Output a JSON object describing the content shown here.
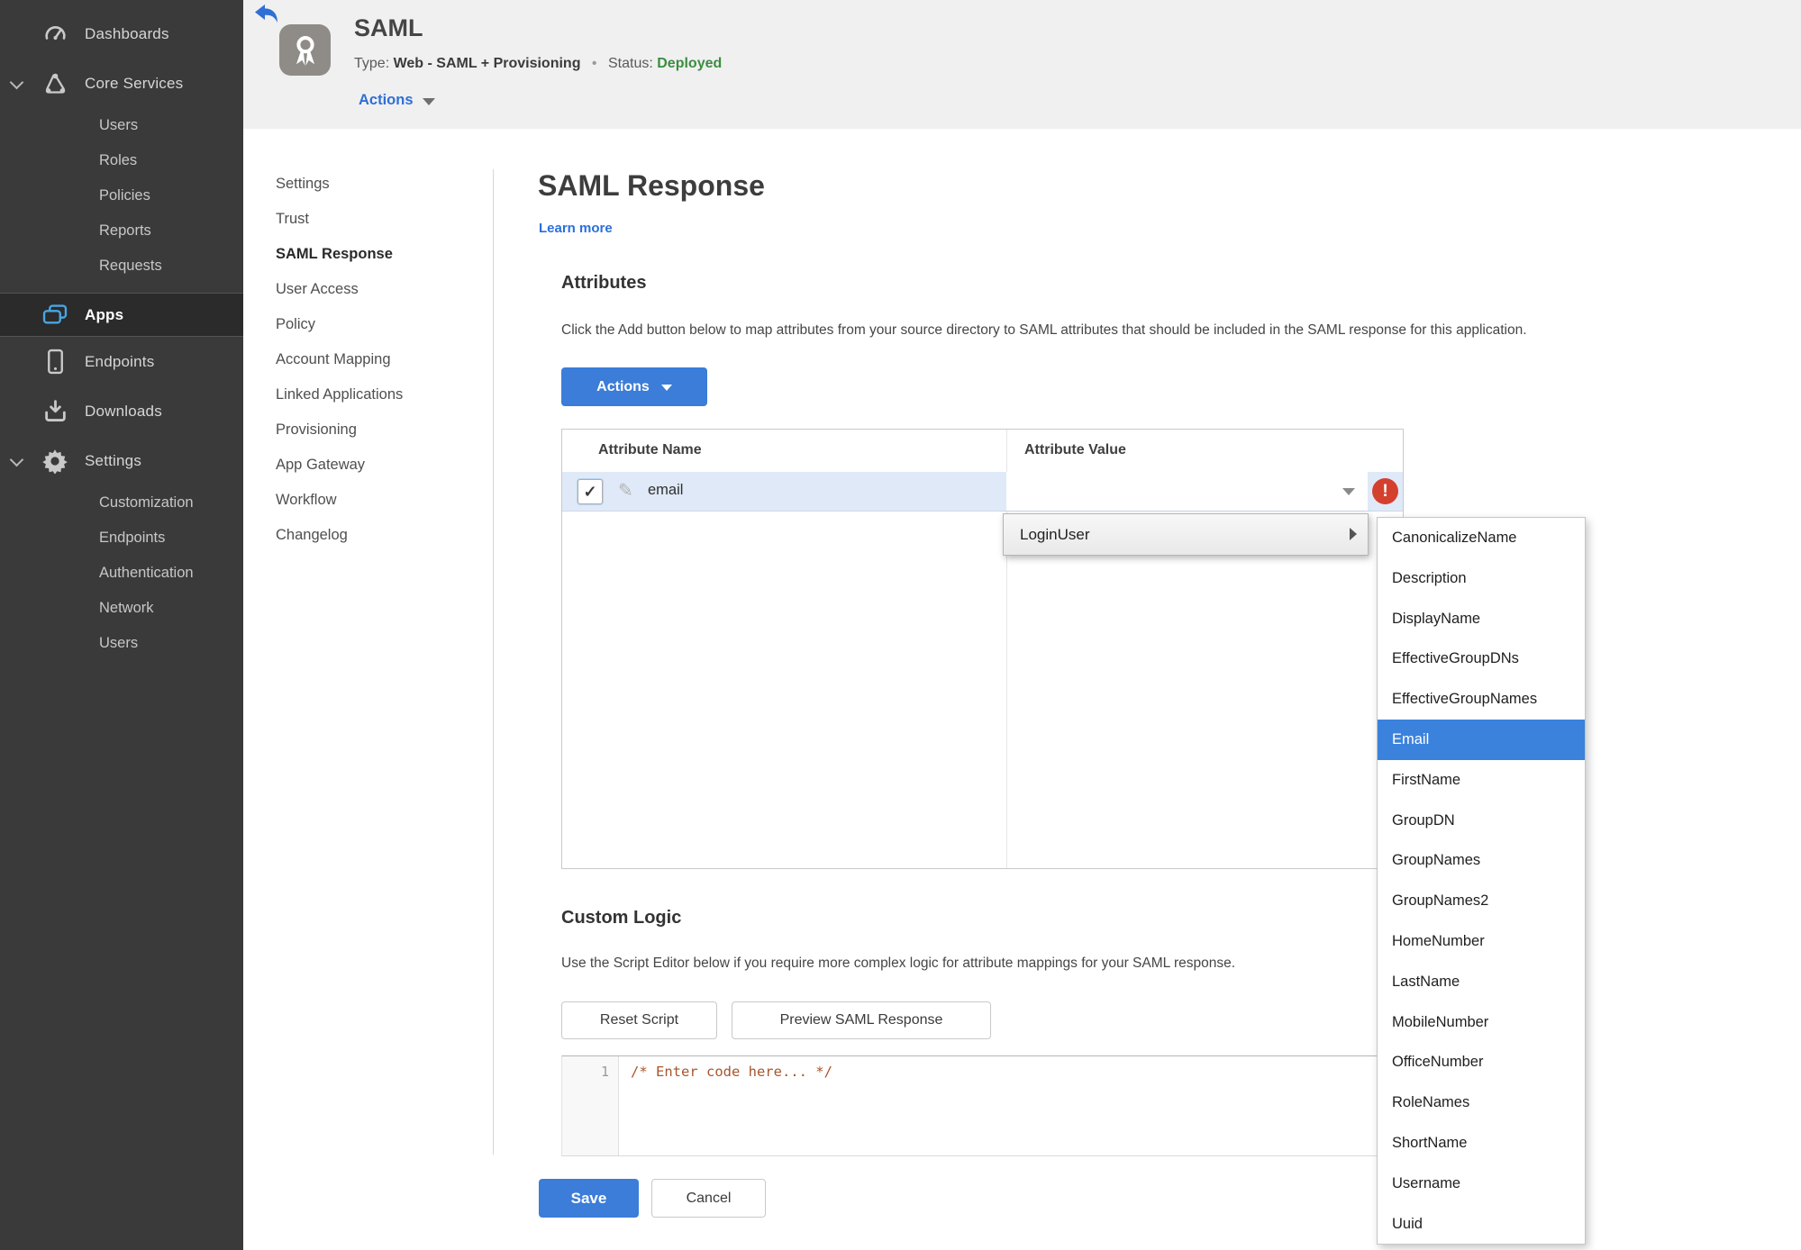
{
  "colors": {
    "accent": "#3b7dd8",
    "link": "#2a6fdb",
    "status_green": "#3c8d40",
    "error_red": "#d4402e",
    "row_highlight": "#dfe9f7",
    "menu_selected": "#3b82dd",
    "sidebar_bg": "#3a3a3a"
  },
  "sidebar": {
    "items": [
      {
        "label": "Dashboards",
        "type": "parent",
        "icon": "dashboard-gauge"
      },
      {
        "label": "Core Services",
        "type": "parent",
        "icon": "core-services",
        "expanded": true
      },
      {
        "label": "Users",
        "type": "child"
      },
      {
        "label": "Roles",
        "type": "child"
      },
      {
        "label": "Policies",
        "type": "child"
      },
      {
        "label": "Reports",
        "type": "child"
      },
      {
        "label": "Requests",
        "type": "child"
      },
      {
        "label": "Apps",
        "type": "parent",
        "icon": "apps",
        "selected": true
      },
      {
        "label": "Endpoints",
        "type": "parent",
        "icon": "endpoints-phone"
      },
      {
        "label": "Downloads",
        "type": "parent",
        "icon": "downloads"
      },
      {
        "label": "Settings",
        "type": "parent",
        "icon": "settings-gear",
        "expanded": true
      },
      {
        "label": "Customization",
        "type": "child"
      },
      {
        "label": "Endpoints",
        "type": "child"
      },
      {
        "label": "Authentication",
        "type": "child"
      },
      {
        "label": "Network",
        "type": "child"
      },
      {
        "label": "Users",
        "type": "child"
      }
    ]
  },
  "header": {
    "title": "SAML",
    "type_label": "Type:",
    "type_value": "Web - SAML + Provisioning",
    "separator": "•",
    "status_label": "Status:",
    "status_value": "Deployed",
    "actions_label": "Actions"
  },
  "subnav": {
    "items": [
      {
        "label": "Settings"
      },
      {
        "label": "Trust"
      },
      {
        "label": "SAML Response",
        "active": true
      },
      {
        "label": "User Access"
      },
      {
        "label": "Policy"
      },
      {
        "label": "Account Mapping"
      },
      {
        "label": "Linked Applications"
      },
      {
        "label": "Provisioning"
      },
      {
        "label": "App Gateway"
      },
      {
        "label": "Workflow"
      },
      {
        "label": "Changelog"
      }
    ]
  },
  "main": {
    "title": "SAML Response",
    "learn_more": "Learn more",
    "attributes": {
      "heading": "Attributes",
      "description": "Click the Add button below to map attributes from your source directory to SAML attributes that should be included in the SAML response for this application.",
      "actions_button": "Actions",
      "table": {
        "columns": [
          "Attribute Name",
          "Attribute Value"
        ],
        "row": {
          "name": "email",
          "checked": true,
          "error": true
        }
      }
    },
    "custom_logic": {
      "heading": "Custom Logic",
      "description": "Use the Script Editor below if you require more complex logic for attribute mappings for your SAML response.",
      "reset_button": "Reset Script",
      "preview_button": "Preview SAML Response",
      "editor": {
        "line_number": "1",
        "code": "/* Enter code here... */"
      }
    },
    "save_button": "Save",
    "cancel_button": "Cancel"
  },
  "dropdown": {
    "label": "LoginUser"
  },
  "submenu": {
    "items": [
      {
        "label": "CanonicalizeName"
      },
      {
        "label": "Description"
      },
      {
        "label": "DisplayName"
      },
      {
        "label": "EffectiveGroupDNs"
      },
      {
        "label": "EffectiveGroupNames"
      },
      {
        "label": "Email",
        "selected": true
      },
      {
        "label": "FirstName"
      },
      {
        "label": "GroupDN"
      },
      {
        "label": "GroupNames"
      },
      {
        "label": "GroupNames2"
      },
      {
        "label": "HomeNumber"
      },
      {
        "label": "LastName"
      },
      {
        "label": "MobileNumber"
      },
      {
        "label": "OfficeNumber"
      },
      {
        "label": "RoleNames"
      },
      {
        "label": "ShortName"
      },
      {
        "label": "Username"
      },
      {
        "label": "Uuid"
      }
    ]
  }
}
